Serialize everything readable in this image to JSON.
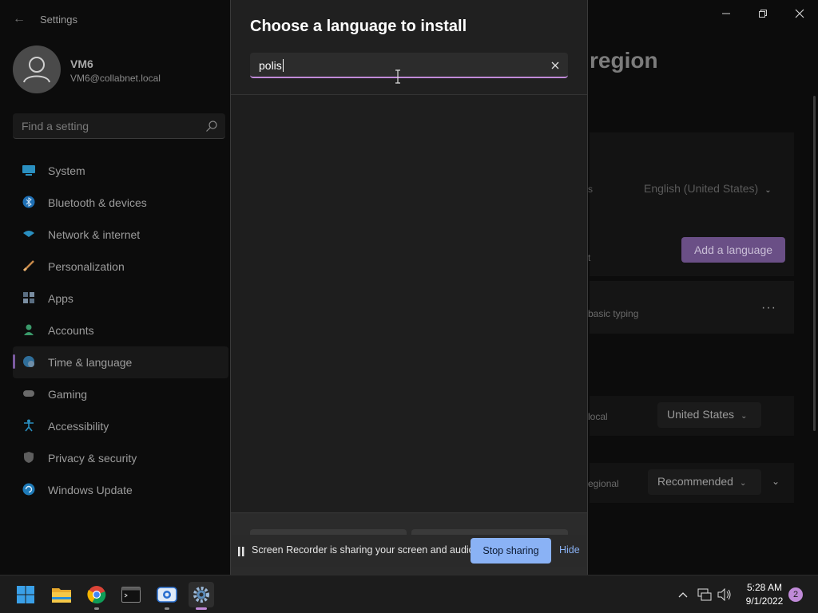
{
  "window": {
    "app_title": "Settings",
    "controls": {
      "minimize": "minimize-icon",
      "maximize": "maximize-icon",
      "close": "close-icon"
    }
  },
  "profile": {
    "name": "VM6",
    "email": "VM6@collabnet.local"
  },
  "search": {
    "placeholder": "Find a setting"
  },
  "nav": {
    "items": [
      {
        "label": "System",
        "icon": "system-icon"
      },
      {
        "label": "Bluetooth & devices",
        "icon": "bluetooth-icon"
      },
      {
        "label": "Network & internet",
        "icon": "network-icon"
      },
      {
        "label": "Personalization",
        "icon": "brush-icon"
      },
      {
        "label": "Apps",
        "icon": "apps-icon"
      },
      {
        "label": "Accounts",
        "icon": "accounts-icon"
      },
      {
        "label": "Time & language",
        "icon": "time-language-icon",
        "active": true
      },
      {
        "label": "Gaming",
        "icon": "gaming-icon"
      },
      {
        "label": "Accessibility",
        "icon": "accessibility-icon"
      },
      {
        "label": "Privacy & security",
        "icon": "shield-icon"
      },
      {
        "label": "Windows Update",
        "icon": "update-icon"
      }
    ]
  },
  "background_page": {
    "title_fragment": "region",
    "display_language_label_fragment": "s",
    "display_language_value": "English (United States)",
    "preferred_label_fragment": "t",
    "add_language_label": "Add a language",
    "typing_label_fragment": "basic typing",
    "country_label_fragment": "local",
    "country_value": "United States",
    "regional_label_fragment": "egional",
    "regional_value": "Recommended"
  },
  "dialog": {
    "title": "Choose a language to install",
    "search_value": "polis",
    "clear_icon": "close-icon"
  },
  "recorder": {
    "message": "Screen Recorder is sharing your screen and audio.",
    "stop_label": "Stop sharing",
    "hide_label": "Hide"
  },
  "taskbar": {
    "apps": [
      "windows-start-icon",
      "file-explorer-icon",
      "chrome-icon",
      "terminal-icon",
      "camera-app-icon",
      "settings-gear-icon"
    ],
    "time": "5:28 AM",
    "date": "9/1/2022",
    "notification_count": "2"
  },
  "colors": {
    "accent": "#c08ad8",
    "add_button": "#6a4f86",
    "stop_button": "#8ab2f5"
  }
}
